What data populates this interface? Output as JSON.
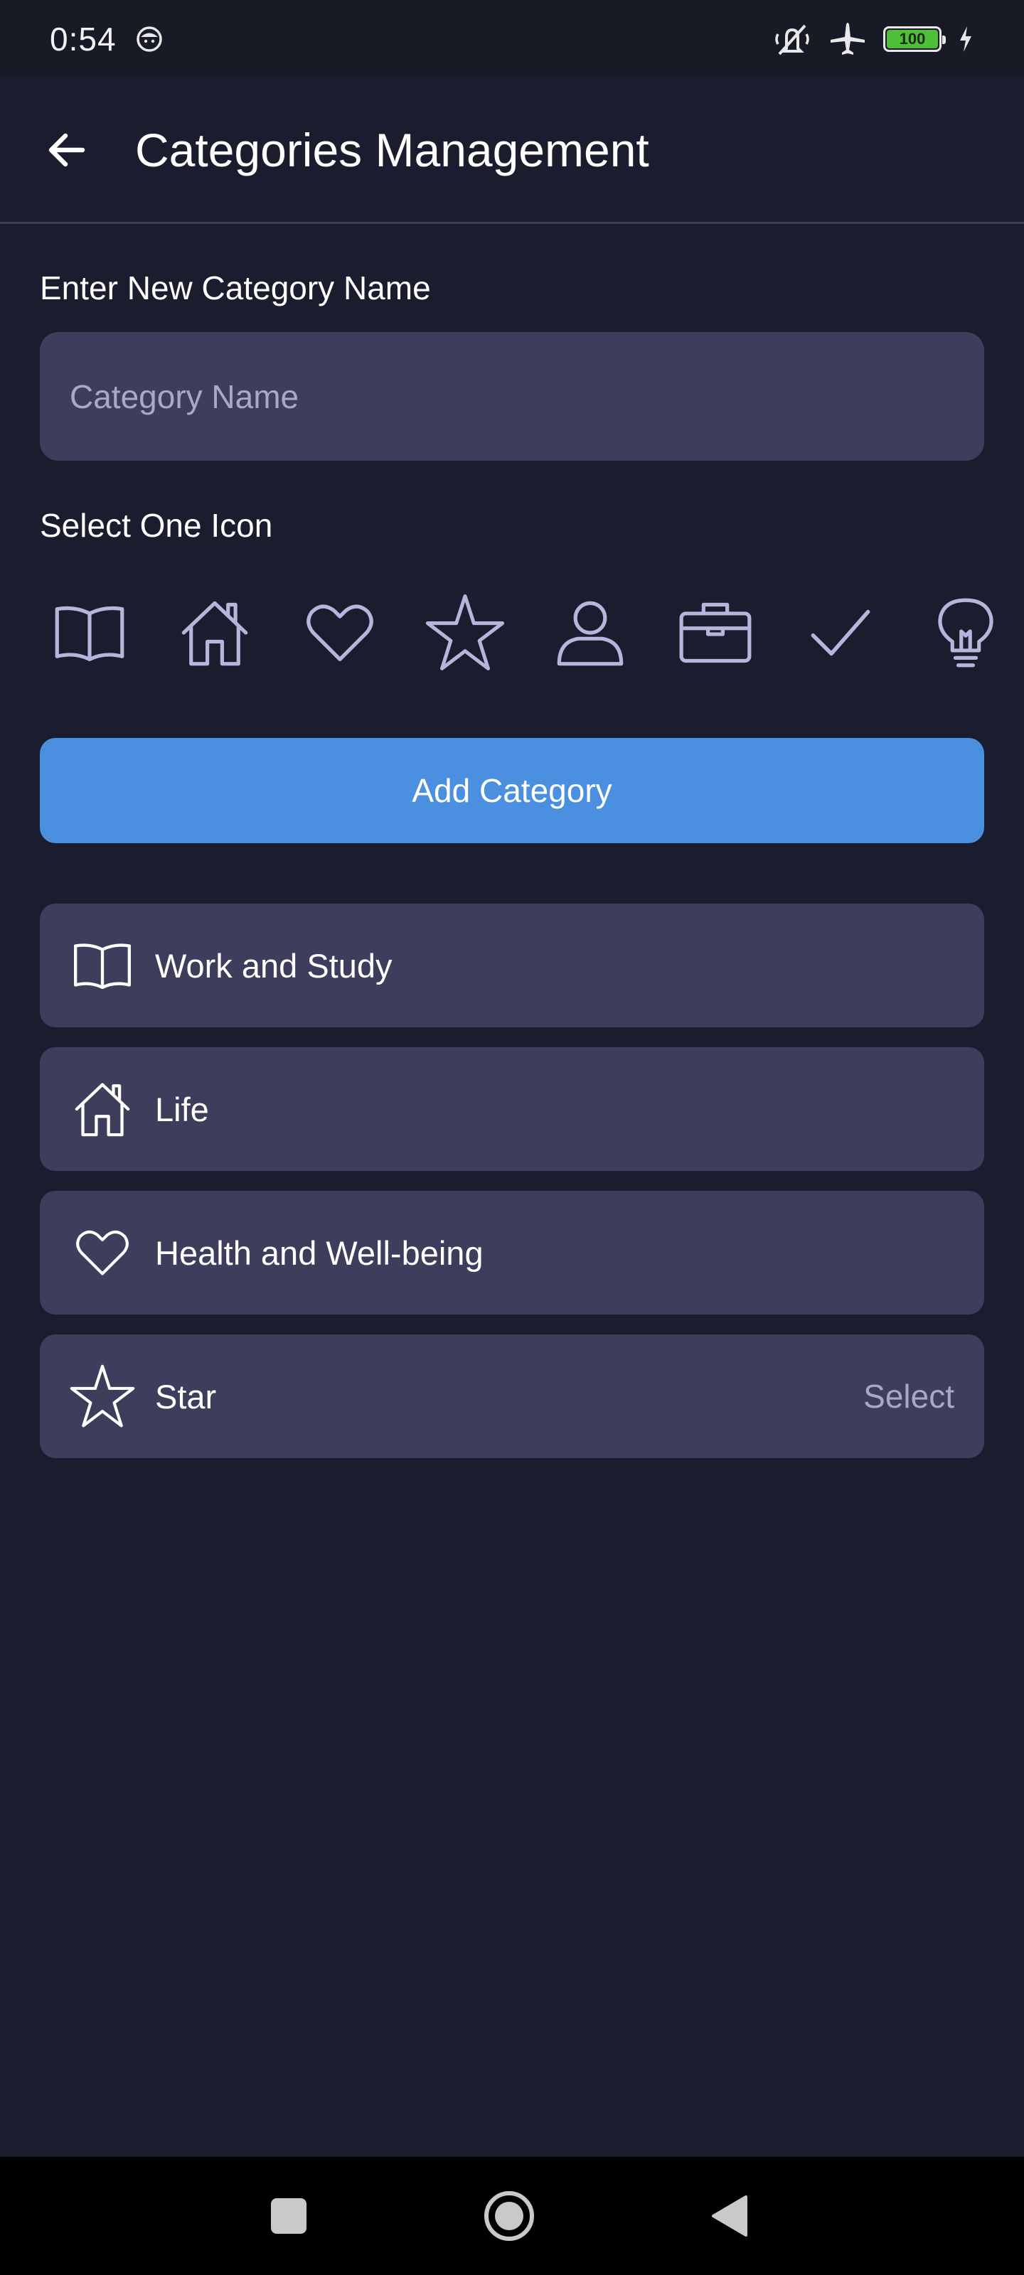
{
  "status_bar": {
    "time": "0:54",
    "battery_level": "100",
    "icons": [
      "face-notification-icon",
      "mute-icon",
      "airplane-mode-icon",
      "battery-icon",
      "charging-icon"
    ]
  },
  "app_bar": {
    "title": "Categories Management",
    "back_icon": "arrow-left-icon"
  },
  "form": {
    "name_label": "Enter New Category Name",
    "name_value": "",
    "name_placeholder": "Category Name",
    "icon_label": "Select One Icon",
    "icon_options": [
      "book-icon",
      "home-icon",
      "heart-icon",
      "star-icon",
      "person-icon",
      "briefcase-icon",
      "check-icon",
      "lightbulb-icon"
    ],
    "add_button": "Add Category"
  },
  "categories": [
    {
      "icon": "book-icon",
      "label": "Work and Study",
      "action": ""
    },
    {
      "icon": "home-icon",
      "label": "Life",
      "action": ""
    },
    {
      "icon": "heart-icon",
      "label": "Health and Well-being",
      "action": ""
    },
    {
      "icon": "star-icon",
      "label": "Star",
      "action": "Select"
    }
  ],
  "nav_bar": {
    "buttons": [
      "recent-apps-icon",
      "home-circle-icon",
      "back-triangle-icon"
    ]
  },
  "colors": {
    "background": "#1b1c2e",
    "surface": "#3e3e5c",
    "accent": "#4a8fe0",
    "icon_tint": "#b7b5dc",
    "muted_text": "#a9a8c9"
  }
}
